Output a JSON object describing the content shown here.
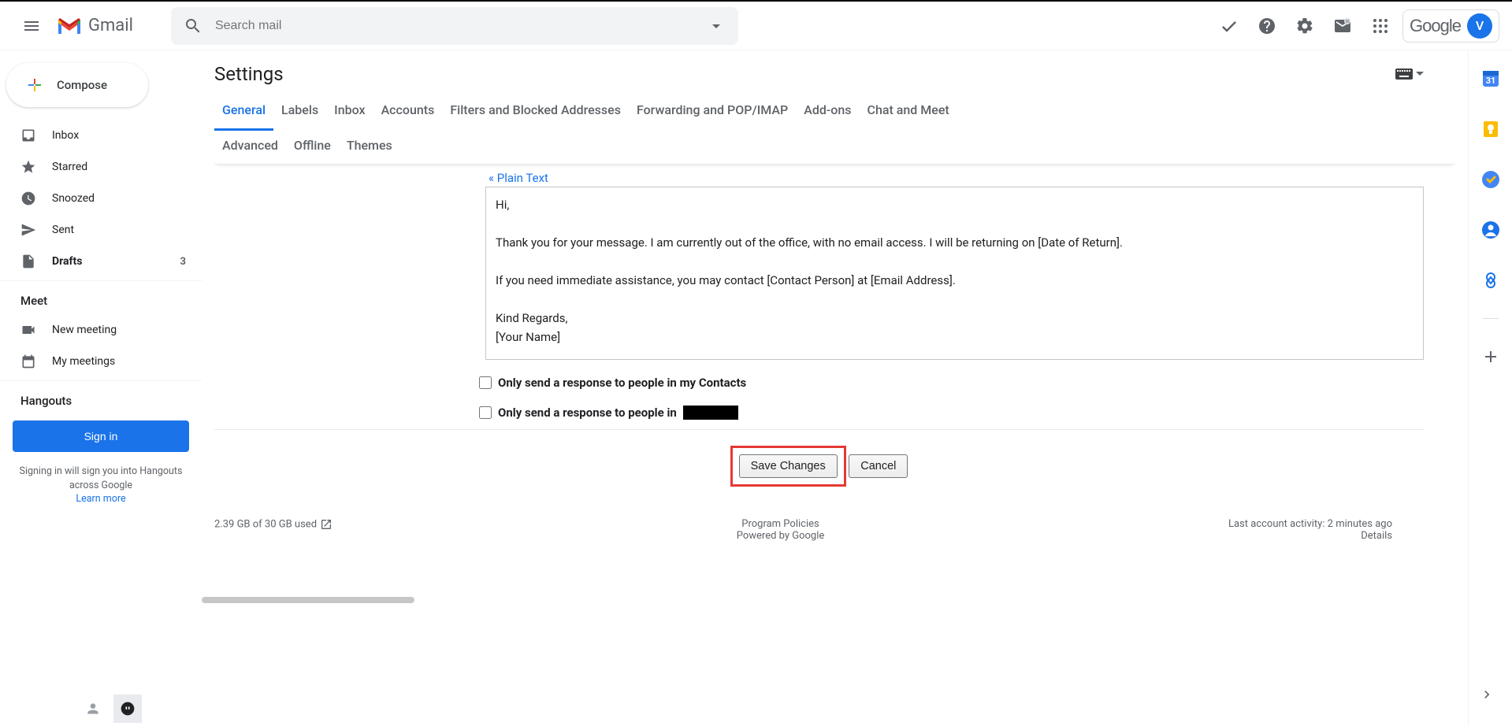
{
  "header": {
    "app_name": "Gmail",
    "search_placeholder": "Search mail",
    "avatar_letter": "V"
  },
  "sidebar": {
    "compose": "Compose",
    "items": [
      {
        "label": "Inbox",
        "bold": false
      },
      {
        "label": "Starred",
        "bold": false
      },
      {
        "label": "Snoozed",
        "bold": false
      },
      {
        "label": "Sent",
        "bold": false
      },
      {
        "label": "Drafts",
        "bold": true,
        "count": "3"
      }
    ],
    "meet_title": "Meet",
    "meet_items": [
      "New meeting",
      "My meetings"
    ],
    "hangouts_title": "Hangouts",
    "signin": "Sign in",
    "signin_note": "Signing in will sign you into Hangouts across Google",
    "learn_more": "Learn more"
  },
  "settings": {
    "title": "Settings",
    "tabs": [
      "General",
      "Labels",
      "Inbox",
      "Accounts",
      "Filters and Blocked Addresses",
      "Forwarding and POP/IMAP",
      "Add-ons",
      "Chat and Meet",
      "Advanced",
      "Offline",
      "Themes"
    ],
    "plain_text": "« Plain Text",
    "editor_text": "Hi,\n\nThank you for your message. I am currently out of the office, with no email access. I will be returning on [Date of Return].\n\nIf you need immediate assistance, you may contact [Contact Person] at [Email Address].\n\nKind Regards,\n[Your Name]",
    "cb1": "Only send a response to people in my Contacts",
    "cb2": "Only send a response to people in ",
    "save": "Save Changes",
    "cancel": "Cancel"
  },
  "footer": {
    "storage": "2.39 GB of 30 GB used",
    "policies": "Program Policies",
    "powered": "Powered by Google",
    "activity": "Last account activity: 2 minutes ago",
    "details": "Details"
  }
}
